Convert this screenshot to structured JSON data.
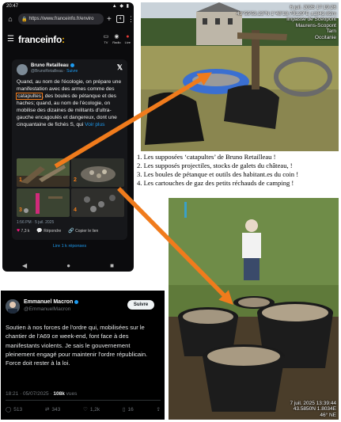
{
  "phone": {
    "status_time": "20:47",
    "status_icons": "▲ ◆ ▮",
    "url": "https://www.franceinfo.fr/enviro",
    "tab_count": "4",
    "site_logo_text": "franceinfo",
    "site_logo_dot": ":",
    "nav_items": [
      {
        "icon": "▭",
        "label": "TV"
      },
      {
        "icon": "◉",
        "label": "Radio"
      },
      {
        "icon": "●",
        "label": "Live"
      }
    ],
    "tweet": {
      "author": "Bruno Retailleau",
      "handle": "@BrunoRetailleau",
      "follow_label": "Suivre",
      "text_before": "Quand, au nom de l'écologie, on prépare une manifestation avec des armes comme des ",
      "text_highlight": "catapultes",
      "text_after": ", des boules de pétanque et des haches; quand, au nom de l'écologie, on mobilise des dizaines de militants d'ultra-gauche encagoulés et dangereux, dont une cinquantaine de fichés S, qui ",
      "more_label": "Voir plus",
      "image_labels": [
        "1",
        "2",
        "3",
        "4"
      ],
      "time_label": "1:56 PM · 5 juil. 2025",
      "likes": "7,3 k",
      "reply_label": "Répondre",
      "copy_label": "Copier le lien",
      "replies_link": "Lire 1 k réponses"
    },
    "android_nav": [
      "◀",
      "●",
      "■"
    ]
  },
  "photo_top": {
    "stamp_lines": [
      "6 juil. 2025 17:19:26",
      "43°55'53.23\"N 1°48'18.79129\"E ±1842.82m",
      "Impasse de Scéopont",
      "Maurens-Scopont",
      "Tarn",
      "Occitanie"
    ]
  },
  "captions": [
    "1. Les supposées ‘catapultes’ de Bruno Retailleau !",
    "2. Les  supposés projectiles, stocks de galets du château, !",
    "3. Les boules de pétanque et outils des habitant.es du coin !",
    "4. Les cartouches de gaz des petits réchauds de camping !"
  ],
  "photo_bottom": {
    "stamp_lines": [
      "7 juil. 2025 13:39:44",
      "43.5850N 1.8034E",
      "46° NE"
    ]
  },
  "macron_tweet": {
    "author": "Emmanuel Macron",
    "handle": "@EmmanuelMacron",
    "follow_label": "Suivre",
    "text": "Soutien à nos forces de l'ordre qui, mobilisées sur le chantier de l'A69 ce week-end, font face à des manifestants violents. Je sais le gouvernement pleinement engagé pour maintenir l'ordre républicain. Force doit rester à la loi.",
    "time": "18:21 · 05/07/2025 · ",
    "views_count": "108k",
    "views_label": " vues",
    "replies": "513",
    "reposts": "343",
    "likes": "1,2k",
    "bookmarks": "16"
  },
  "colors": {
    "arrow": "#f07b1c",
    "x_blue": "#1d9bf0",
    "phone_bg": "#0b0b0d"
  }
}
